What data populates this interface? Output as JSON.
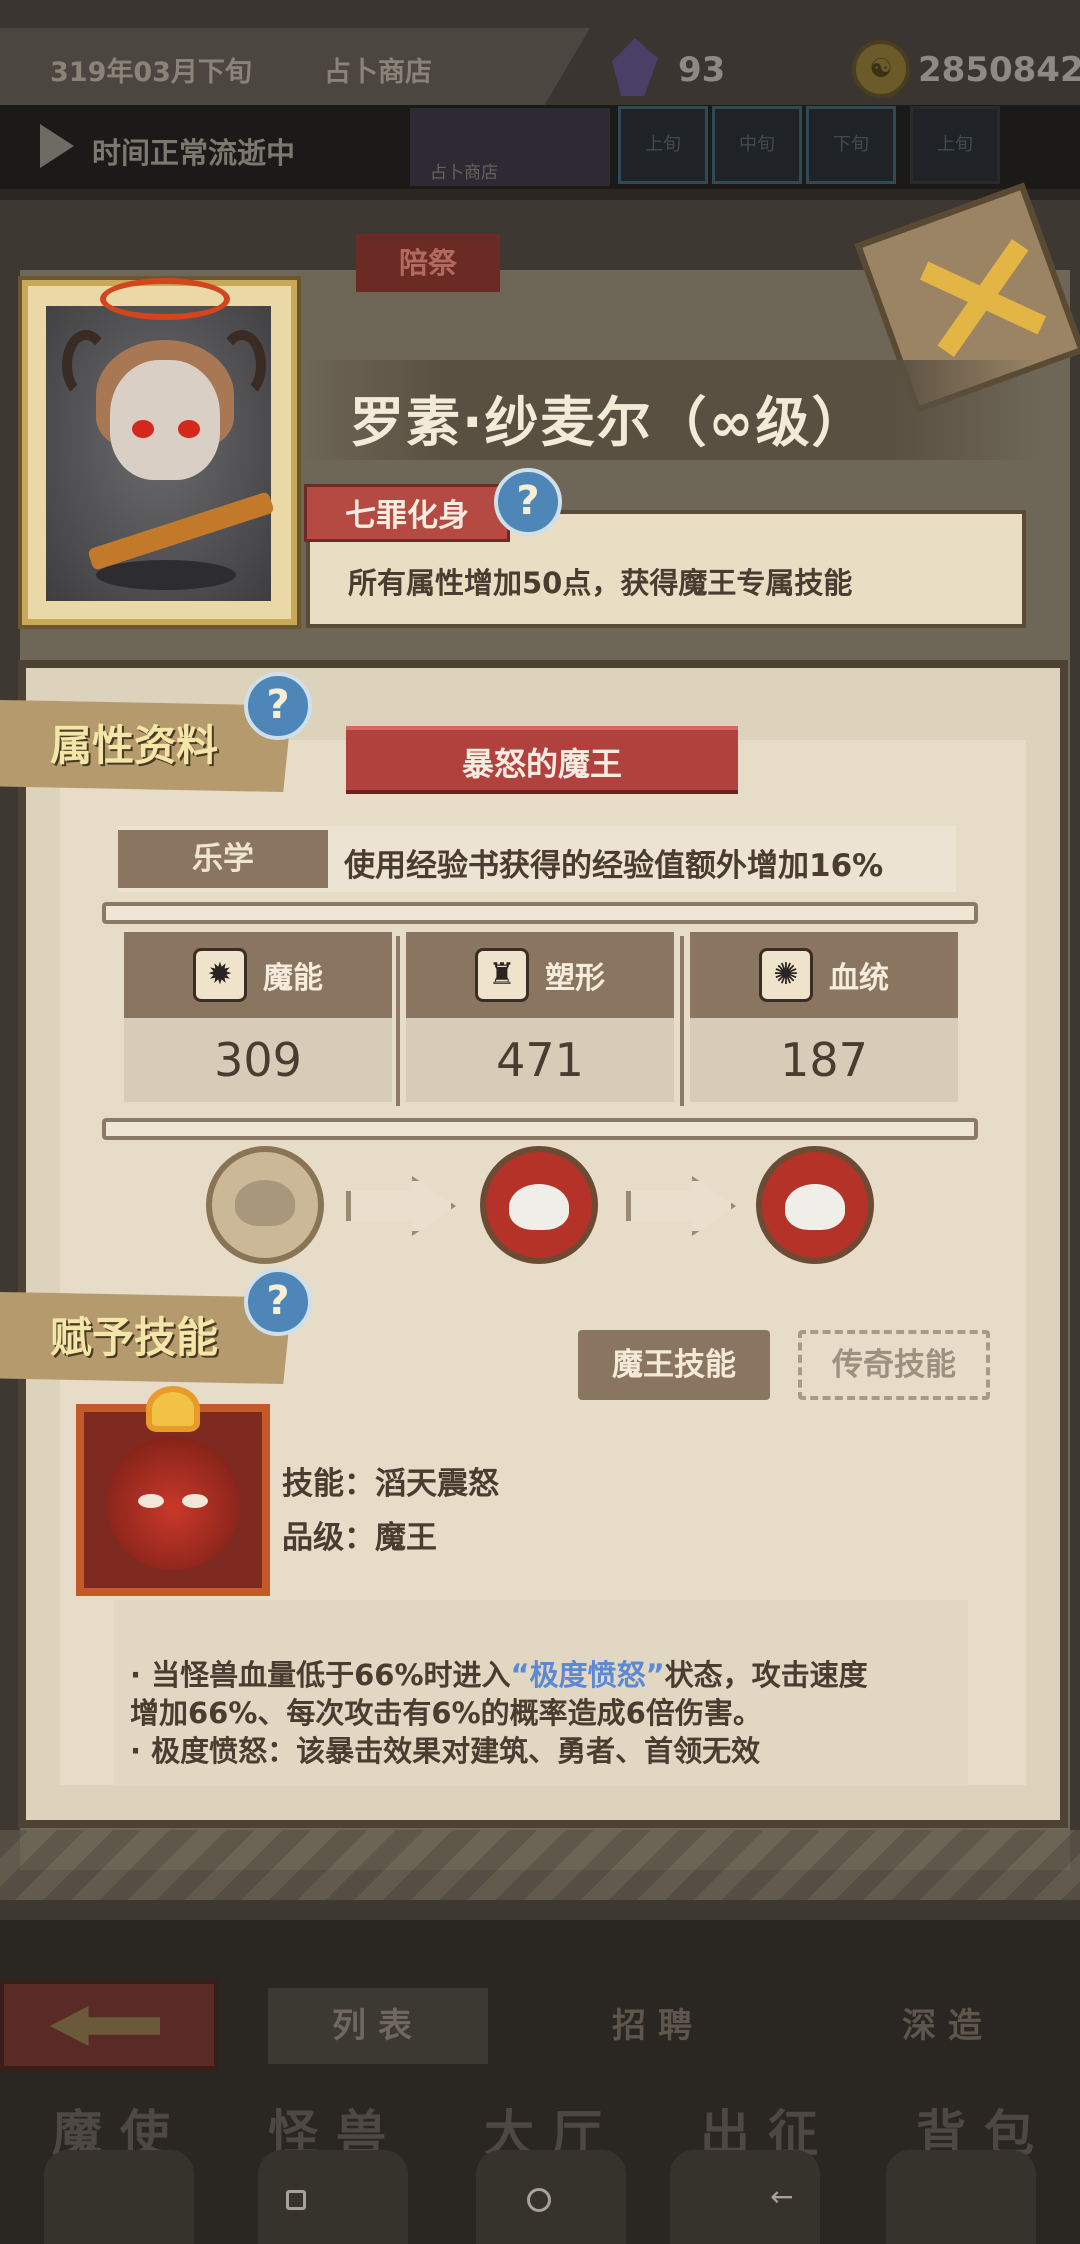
{
  "status_bar": {
    "date": "319年03月下旬",
    "location": "占卜商店",
    "gems": "93",
    "coin_symbol": "☯",
    "coins": "2850842"
  },
  "time_bar": {
    "status": "时间正常流逝中",
    "mini_label": "占卜商店",
    "slots": [
      "上旬",
      "中旬",
      "下旬",
      "上旬"
    ]
  },
  "character": {
    "side_tag": "陪祭",
    "name": "罗素·纱麦尔（∞级）",
    "trait_tag": "七罪化身",
    "trait_desc": "所有属性增加50点，获得魔王专属技能"
  },
  "attributes": {
    "section_title": "属性资料",
    "title_ribbon": "暴怒的魔王",
    "talent_tag": "乐学",
    "talent_desc": "使用经验书获得的经验值额外增加16%",
    "stats": [
      {
        "label": "魔能",
        "value": "309",
        "icon": "flame-icon"
      },
      {
        "label": "塑形",
        "value": "471",
        "icon": "body-icon"
      },
      {
        "label": "血统",
        "value": "187",
        "icon": "gear-icon"
      }
    ]
  },
  "skills": {
    "section_title": "赋予技能",
    "tab_demon": "魔王技能",
    "tab_legend": "传奇技能",
    "skill_label": "技能：滔天震怒",
    "grade_label": "品级：魔王",
    "desc_line1_a": "·   当怪兽血量低于66%时进入",
    "desc_line1_hl": "“极度愤怒”",
    "desc_line1_b": "状态，攻击速度",
    "desc_line2": "增加66%、每次攻击有6%的概率造成6倍伤害。",
    "desc_line3": "·   极度愤怒：该暴击效果对建筑、勇者、首领无效"
  },
  "bottom_nav": {
    "subtabs": [
      "列表",
      "招聘",
      "深造"
    ],
    "maintabs": [
      "魔使",
      "怪兽",
      "大厅",
      "出征",
      "背包"
    ],
    "sys_back": "←"
  },
  "help_glyph": "?"
}
